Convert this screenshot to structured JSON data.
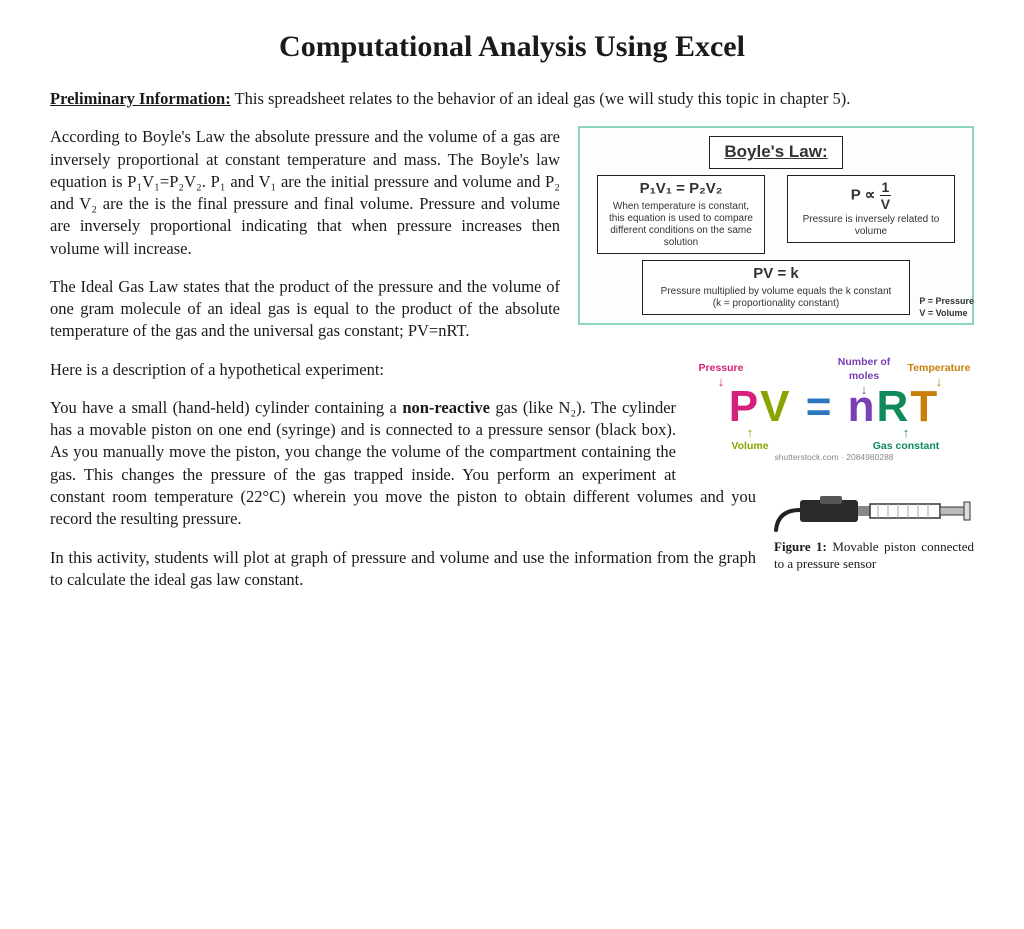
{
  "title": "Computational Analysis Using Excel",
  "prelim_label": "Preliminary Information:",
  "prelim_text": "  This spreadsheet relates to the behavior of an ideal gas (we will study this topic in chapter 5).",
  "boyle_para": "According to Boyle's Law the absolute pressure and the volume of a gas are inversely proportional at constant temperature and mass. The Boyle's law equation is P₁V₁=P₂V₂.  P₁ and V₁ are the initial pressure and volume and P₂ and V₂ are the is the final pressure and final volume.  Pressure and volume are inversely proportional indicating that when pressure increases then volume will increase.",
  "ideal_para": "The Ideal Gas Law states that the product of the pressure and the volume of one gram molecule of an ideal gas is equal to the product of the absolute temperature of the gas and the universal gas constant; PV=nRT.",
  "hyp_desc": "Here is a description of a hypothetical experiment:",
  "exp_para_a": "You have a small (hand-held) cylinder containing a ",
  "exp_nonreactive": "non-reactive",
  "exp_para_b": " gas (like N₂).   The cylinder has a movable piston on one end (syringe) and is connected to a pressure sensor (black box).  As you manually move the piston, you change the volume of the compartment containing the gas. This changes the pressure of the gas trapped inside. You perform an experiment at constant room temperature (22°C) wherein you move the piston to obtain different volumes and you record the resulting pressure.",
  "activity_para": "In this activity, students will plot at graph of pressure and volume and use the information from the graph to calculate the ideal gas law constant.",
  "boyle_box": {
    "title": "Boyle's Law:",
    "eq1": "P₁V₁ = P₂V₂",
    "eq1_note": "When temperature is constant, this equation is used to compare different conditions on the same solution",
    "eq2_prefix": "P ∝",
    "eq2_num": "1",
    "eq2_den": "V",
    "eq2_note": "Pressure is inversely related to volume",
    "eq3": "PV = k",
    "eq3_note1": "Pressure multiplied by volume equals the k constant",
    "eq3_note2": "(k = proportionality constant)",
    "legend1": "P = Pressure",
    "legend2": "V = Volume"
  },
  "pvnrt": {
    "labels": {
      "P": "Pressure",
      "V": "Volume",
      "n": "Number of moles",
      "R": "Gas constant",
      "T": "Temperature"
    },
    "credit": "shutterstock.com · 2084980288"
  },
  "fig1": {
    "label": "Figure 1:",
    "caption": " Movable piston connected to a pressure sensor"
  }
}
